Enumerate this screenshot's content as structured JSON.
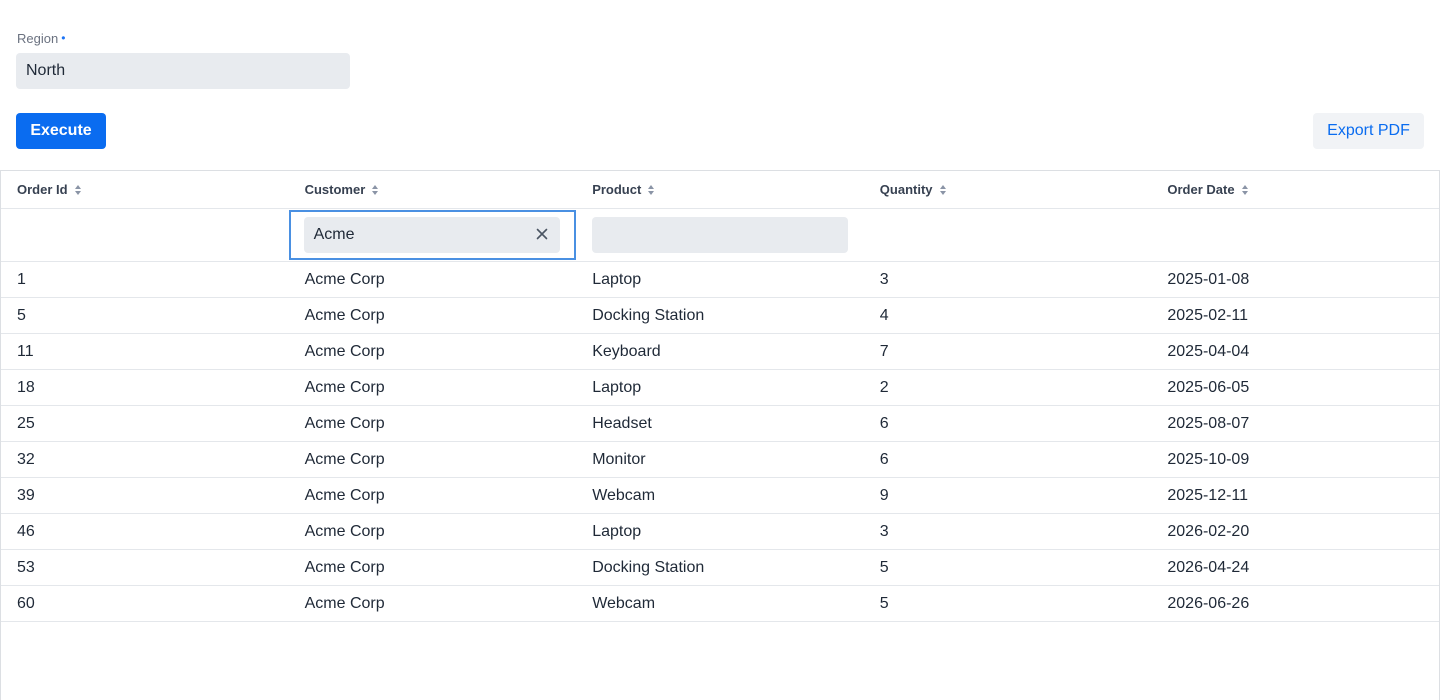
{
  "filter_form": {
    "region_label": "Region",
    "region_required_marker": "•",
    "region_value": "North"
  },
  "toolbar": {
    "execute_label": "Execute",
    "export_label": "Export PDF"
  },
  "table": {
    "columns": [
      {
        "label": "Order Id"
      },
      {
        "label": "Customer"
      },
      {
        "label": "Product"
      },
      {
        "label": "Quantity"
      },
      {
        "label": "Order Date"
      }
    ],
    "filters": {
      "customer": "Acme",
      "product": ""
    },
    "rows": [
      {
        "order_id": "1",
        "customer": "Acme Corp",
        "product": "Laptop",
        "quantity": "3",
        "order_date": "2025-01-08"
      },
      {
        "order_id": "5",
        "customer": "Acme Corp",
        "product": "Docking Station",
        "quantity": "4",
        "order_date": "2025-02-11"
      },
      {
        "order_id": "11",
        "customer": "Acme Corp",
        "product": "Keyboard",
        "quantity": "7",
        "order_date": "2025-04-04"
      },
      {
        "order_id": "18",
        "customer": "Acme Corp",
        "product": "Laptop",
        "quantity": "2",
        "order_date": "2025-06-05"
      },
      {
        "order_id": "25",
        "customer": "Acme Corp",
        "product": "Headset",
        "quantity": "6",
        "order_date": "2025-08-07"
      },
      {
        "order_id": "32",
        "customer": "Acme Corp",
        "product": "Monitor",
        "quantity": "6",
        "order_date": "2025-10-09"
      },
      {
        "order_id": "39",
        "customer": "Acme Corp",
        "product": "Webcam",
        "quantity": "9",
        "order_date": "2025-12-11"
      },
      {
        "order_id": "46",
        "customer": "Acme Corp",
        "product": "Laptop",
        "quantity": "3",
        "order_date": "2026-02-20"
      },
      {
        "order_id": "53",
        "customer": "Acme Corp",
        "product": "Docking Station",
        "quantity": "5",
        "order_date": "2026-04-24"
      },
      {
        "order_id": "60",
        "customer": "Acme Corp",
        "product": "Webcam",
        "quantity": "5",
        "order_date": "2026-06-26"
      }
    ]
  },
  "icons": {
    "sort": "sort-icon",
    "clear": "close-icon"
  },
  "colors": {
    "primary": "#0a6cf0",
    "focus_border": "#4a90e2",
    "input_background": "#e8ebef"
  }
}
